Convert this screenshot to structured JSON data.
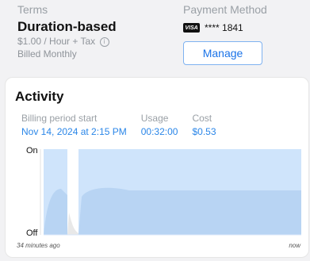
{
  "terms": {
    "label": "Terms",
    "title": "Duration-based",
    "rate": "$1.00 / Hour + Tax",
    "billing": "Billed Monthly",
    "info_icon": "info-icon"
  },
  "payment": {
    "label": "Payment Method",
    "card_brand": "VISA",
    "card_number": "**** 1841",
    "manage_label": "Manage"
  },
  "activity": {
    "title": "Activity",
    "billing_start_label": "Billing period start",
    "billing_start_value": "Nov 14, 2024 at 2:15 PM",
    "usage_label": "Usage",
    "usage_value": "00:32:00",
    "cost_label": "Cost",
    "cost_value": "$0.53"
  },
  "chart_data": {
    "type": "area",
    "y_labels": [
      "On",
      "Off"
    ],
    "x_labels": [
      "34 minutes ago",
      "now"
    ],
    "series": [
      {
        "values": [
          1,
          1,
          0,
          1,
          1,
          1,
          1,
          1,
          1,
          1
        ]
      }
    ],
    "colors": {
      "fill": "#cfe4fb",
      "inner": "#b8d4f3",
      "accent": "#1a73e8"
    }
  }
}
